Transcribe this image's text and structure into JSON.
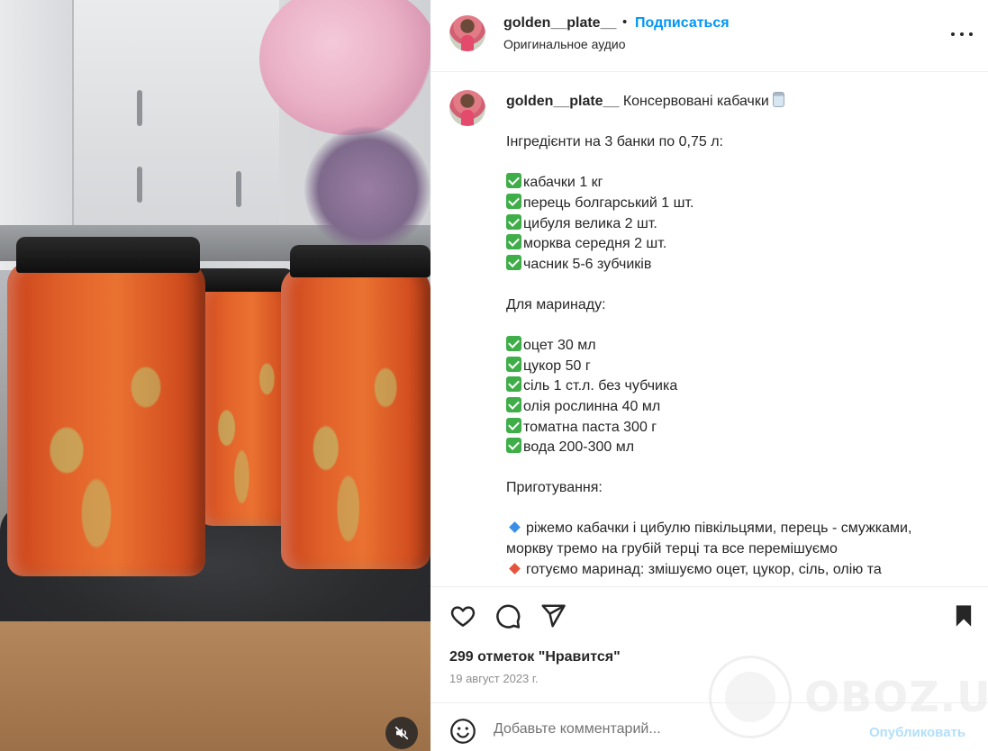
{
  "header": {
    "username": "golden__plate__",
    "separator": "•",
    "follow_label": "Подписаться",
    "audio_label": "Оригинальное аудио"
  },
  "caption": {
    "username": "golden__plate__",
    "title": "Консервовані кабачки",
    "lines": {
      "ingredients_header": "Інгредієнти на 3 банки по 0,75 л:",
      "ing1": "кабачки 1 кг",
      "ing2": "перець болгарський 1 шт.",
      "ing3": "цибуля велика 2 шт.",
      "ing4": "морква середня 2 шт.",
      "ing5": "часник 5-6 зубчиків",
      "marinade_header": "Для маринаду:",
      "mar1": "оцет 30 мл",
      "mar2": "цукор 50 г",
      "mar3": "сіль 1 ст.л. без чубчика",
      "mar4": "олія рослинна 40 мл",
      "mar5": "томатна паста 300 г",
      "mar6": "вода 200-300 мл",
      "prep_header": "Приготування:",
      "step1a": "ріжемо кабачки і цибулю півкільцями, перець - смужками,",
      "step1b": "моркву тремо на грубій терці та все перемішуємо",
      "step2": "готуємо маринад: змішуємо оцет, цукор, сіль, олію та"
    }
  },
  "actions": {
    "like_icon": "heart-icon",
    "comment_icon": "comment-bubble-icon",
    "share_icon": "paper-plane-icon",
    "save_icon": "bookmark-icon",
    "likes_text": "299 отметок \"Нравится\"",
    "date_text": "19 август 2023 г."
  },
  "comment": {
    "placeholder": "Добавьте комментарий...",
    "publish_label": "Опубликовать"
  },
  "watermark": {
    "text": "OBOZ.UA"
  },
  "colors": {
    "accent": "#0095f6",
    "publish_disabled": "#b2dffc",
    "muted_text": "#8e8e8e",
    "check_green": "#3fae49"
  }
}
